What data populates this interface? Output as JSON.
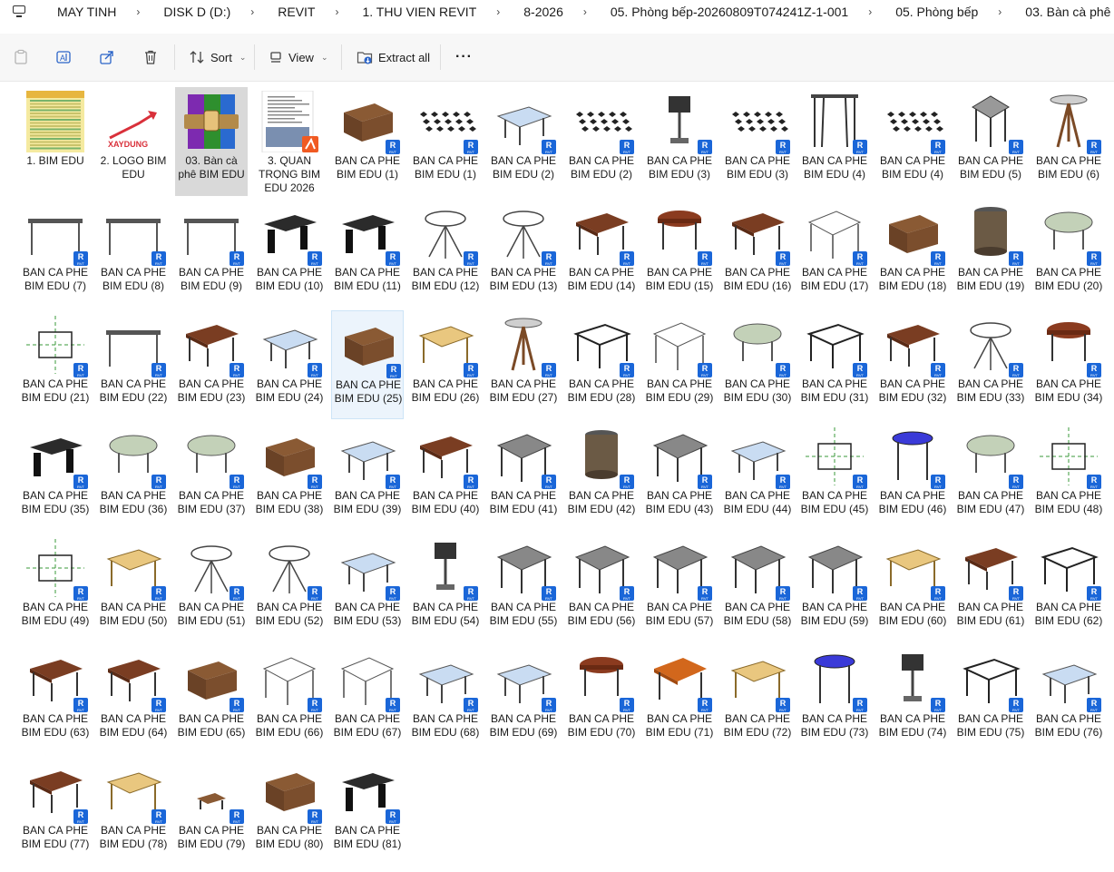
{
  "breadcrumb": {
    "items": [
      "MAY TINH",
      "DISK D (D:)",
      "REVIT",
      "1. THU VIEN REVIT",
      "8-2026",
      "05. Phòng bếp-20260809T074241Z-1-001",
      "05. Phòng bếp",
      "03. Bàn cà phê"
    ],
    "separator": "›"
  },
  "toolbar": {
    "sort_label": "Sort",
    "view_label": "View",
    "extract_label": "Extract all",
    "more_label": "···"
  },
  "badge": {
    "letter": "R",
    "sub": "RVT"
  },
  "files": [
    {
      "name": "1. BIM EDU",
      "type": "image"
    },
    {
      "name": "2. LOGO BIM EDU",
      "type": "logo"
    },
    {
      "name": "03. Bàn cà phê BIM EDU",
      "type": "archive",
      "selected": true
    },
    {
      "name": "3. QUAN TRỌNG BIM EDU 2026",
      "type": "doc"
    },
    {
      "name": "BAN CA PHE BIM EDU (1)",
      "type": "rvt",
      "icon": "box"
    },
    {
      "name": "BAN CA PHE BIM EDU (1)",
      "type": "rvt",
      "icon": "pattern"
    },
    {
      "name": "BAN CA PHE BIM EDU (2)",
      "type": "rvt",
      "icon": "glass"
    },
    {
      "name": "BAN CA PHE BIM EDU (2)",
      "type": "rvt",
      "icon": "pattern"
    },
    {
      "name": "BAN CA PHE BIM EDU (3)",
      "type": "rvt",
      "icon": "pedestal"
    },
    {
      "name": "BAN CA PHE BIM EDU (3)",
      "type": "rvt",
      "icon": "pattern"
    },
    {
      "name": "BAN CA PHE BIM EDU (4)",
      "type": "rvt",
      "icon": "tall"
    },
    {
      "name": "BAN CA PHE BIM EDU (4)",
      "type": "rvt",
      "icon": "pattern"
    },
    {
      "name": "BAN CA PHE BIM EDU (5)",
      "type": "rvt",
      "icon": "square"
    },
    {
      "name": "BAN CA PHE BIM EDU (6)",
      "type": "rvt",
      "icon": "tripod"
    },
    {
      "name": "BAN CA PHE BIM EDU (7)",
      "type": "rvt",
      "icon": "long"
    },
    {
      "name": "BAN CA PHE BIM EDU (8)",
      "type": "rvt",
      "icon": "long"
    },
    {
      "name": "BAN CA PHE BIM EDU (9)",
      "type": "rvt",
      "icon": "long"
    },
    {
      "name": "BAN CA PHE BIM EDU (10)",
      "type": "rvt",
      "icon": "dark"
    },
    {
      "name": "BAN CA PHE BIM EDU (11)",
      "type": "rvt",
      "icon": "dark"
    },
    {
      "name": "BAN CA PHE BIM EDU (12)",
      "type": "rvt",
      "icon": "round"
    },
    {
      "name": "BAN CA PHE BIM EDU (13)",
      "type": "rvt",
      "icon": "round"
    },
    {
      "name": "BAN CA PHE BIM EDU (14)",
      "type": "rvt",
      "icon": "wood"
    },
    {
      "name": "BAN CA PHE BIM EDU (15)",
      "type": "rvt",
      "icon": "roundwood"
    },
    {
      "name": "BAN CA PHE BIM EDU (16)",
      "type": "rvt",
      "icon": "wood"
    },
    {
      "name": "BAN CA PHE BIM EDU (17)",
      "type": "rvt",
      "icon": "white"
    },
    {
      "name": "BAN CA PHE BIM EDU (18)",
      "type": "rvt",
      "icon": "box"
    },
    {
      "name": "BAN CA PHE BIM EDU (19)",
      "type": "rvt",
      "icon": "drum"
    },
    {
      "name": "BAN CA PHE BIM EDU (20)",
      "type": "rvt",
      "icon": "oval"
    },
    {
      "name": "BAN CA PHE BIM EDU (21)",
      "type": "rvt",
      "icon": "plan"
    },
    {
      "name": "BAN CA PHE BIM EDU (22)",
      "type": "rvt",
      "icon": "long"
    },
    {
      "name": "BAN CA PHE BIM EDU (23)",
      "type": "rvt",
      "icon": "wood"
    },
    {
      "name": "BAN CA PHE BIM EDU (24)",
      "type": "rvt",
      "icon": "glass"
    },
    {
      "name": "BAN CA PHE BIM EDU (25)",
      "type": "rvt",
      "icon": "box",
      "hover": true
    },
    {
      "name": "BAN CA PHE BIM EDU (26)",
      "type": "rvt",
      "icon": "yellow"
    },
    {
      "name": "BAN CA PHE BIM EDU (27)",
      "type": "rvt",
      "icon": "tripod"
    },
    {
      "name": "BAN CA PHE BIM EDU (28)",
      "type": "rvt",
      "icon": "frame"
    },
    {
      "name": "BAN CA PHE BIM EDU (29)",
      "type": "rvt",
      "icon": "white"
    },
    {
      "name": "BAN CA PHE BIM EDU (30)",
      "type": "rvt",
      "icon": "oval"
    },
    {
      "name": "BAN CA PHE BIM EDU (31)",
      "type": "rvt",
      "icon": "frame"
    },
    {
      "name": "BAN CA PHE BIM EDU (32)",
      "type": "rvt",
      "icon": "wood"
    },
    {
      "name": "BAN CA PHE BIM EDU (33)",
      "type": "rvt",
      "icon": "round"
    },
    {
      "name": "BAN CA PHE BIM EDU (34)",
      "type": "rvt",
      "icon": "roundwood"
    },
    {
      "name": "BAN CA PHE BIM EDU (35)",
      "type": "rvt",
      "icon": "dark"
    },
    {
      "name": "BAN CA PHE BIM EDU (36)",
      "type": "rvt",
      "icon": "oval"
    },
    {
      "name": "BAN CA PHE BIM EDU (37)",
      "type": "rvt",
      "icon": "oval"
    },
    {
      "name": "BAN CA PHE BIM EDU (38)",
      "type": "rvt",
      "icon": "box"
    },
    {
      "name": "BAN CA PHE BIM EDU (39)",
      "type": "rvt",
      "icon": "glass"
    },
    {
      "name": "BAN CA PHE BIM EDU (40)",
      "type": "rvt",
      "icon": "wood"
    },
    {
      "name": "BAN CA PHE BIM EDU (41)",
      "type": "rvt",
      "icon": "gray"
    },
    {
      "name": "BAN CA PHE BIM EDU (42)",
      "type": "rvt",
      "icon": "drum"
    },
    {
      "name": "BAN CA PHE BIM EDU (43)",
      "type": "rvt",
      "icon": "gray"
    },
    {
      "name": "BAN CA PHE BIM EDU (44)",
      "type": "rvt",
      "icon": "glass"
    },
    {
      "name": "BAN CA PHE BIM EDU (45)",
      "type": "rvt",
      "icon": "plan"
    },
    {
      "name": "BAN CA PHE BIM EDU (46)",
      "type": "rvt",
      "icon": "blue"
    },
    {
      "name": "BAN CA PHE BIM EDU (47)",
      "type": "rvt",
      "icon": "oval"
    },
    {
      "name": "BAN CA PHE BIM EDU (48)",
      "type": "rvt",
      "icon": "plan"
    },
    {
      "name": "BAN CA PHE BIM EDU (49)",
      "type": "rvt",
      "icon": "plan"
    },
    {
      "name": "BAN CA PHE BIM EDU (50)",
      "type": "rvt",
      "icon": "yellow"
    },
    {
      "name": "BAN CA PHE BIM EDU (51)",
      "type": "rvt",
      "icon": "round"
    },
    {
      "name": "BAN CA PHE BIM EDU (52)",
      "type": "rvt",
      "icon": "round"
    },
    {
      "name": "BAN CA PHE BIM EDU (53)",
      "type": "rvt",
      "icon": "glass"
    },
    {
      "name": "BAN CA PHE BIM EDU (54)",
      "type": "rvt",
      "icon": "pedestal"
    },
    {
      "name": "BAN CA PHE BIM EDU (55)",
      "type": "rvt",
      "icon": "gray"
    },
    {
      "name": "BAN CA PHE BIM EDU (56)",
      "type": "rvt",
      "icon": "gray"
    },
    {
      "name": "BAN CA PHE BIM EDU (57)",
      "type": "rvt",
      "icon": "gray"
    },
    {
      "name": "BAN CA PHE BIM EDU (58)",
      "type": "rvt",
      "icon": "gray"
    },
    {
      "name": "BAN CA PHE BIM EDU (59)",
      "type": "rvt",
      "icon": "gray"
    },
    {
      "name": "BAN CA PHE BIM EDU (60)",
      "type": "rvt",
      "icon": "yellow"
    },
    {
      "name": "BAN CA PHE BIM EDU (61)",
      "type": "rvt",
      "icon": "wood"
    },
    {
      "name": "BAN CA PHE BIM EDU (62)",
      "type": "rvt",
      "icon": "frame"
    },
    {
      "name": "BAN CA PHE BIM EDU (63)",
      "type": "rvt",
      "icon": "wood"
    },
    {
      "name": "BAN CA PHE BIM EDU (64)",
      "type": "rvt",
      "icon": "wood"
    },
    {
      "name": "BAN CA PHE BIM EDU (65)",
      "type": "rvt",
      "icon": "box"
    },
    {
      "name": "BAN CA PHE BIM EDU (66)",
      "type": "rvt",
      "icon": "white"
    },
    {
      "name": "BAN CA PHE BIM EDU (67)",
      "type": "rvt",
      "icon": "white"
    },
    {
      "name": "BAN CA PHE BIM EDU (68)",
      "type": "rvt",
      "icon": "glass"
    },
    {
      "name": "BAN CA PHE BIM EDU (69)",
      "type": "rvt",
      "icon": "glass"
    },
    {
      "name": "BAN CA PHE BIM EDU (70)",
      "type": "rvt",
      "icon": "roundwood"
    },
    {
      "name": "BAN CA PHE BIM EDU (71)",
      "type": "rvt",
      "icon": "orange"
    },
    {
      "name": "BAN CA PHE BIM EDU (72)",
      "type": "rvt",
      "icon": "yellow"
    },
    {
      "name": "BAN CA PHE BIM EDU (73)",
      "type": "rvt",
      "icon": "blue"
    },
    {
      "name": "BAN CA PHE BIM EDU (74)",
      "type": "rvt",
      "icon": "pedestal"
    },
    {
      "name": "BAN CA PHE BIM EDU (75)",
      "type": "rvt",
      "icon": "frame"
    },
    {
      "name": "BAN CA PHE BIM EDU (76)",
      "type": "rvt",
      "icon": "glass"
    },
    {
      "name": "BAN CA PHE BIM EDU (77)",
      "type": "rvt",
      "icon": "wood"
    },
    {
      "name": "BAN CA PHE BIM EDU (78)",
      "type": "rvt",
      "icon": "yellow"
    },
    {
      "name": "BAN CA PHE BIM EDU (79)",
      "type": "rvt",
      "icon": "small"
    },
    {
      "name": "BAN CA PHE BIM EDU (80)",
      "type": "rvt",
      "icon": "box"
    },
    {
      "name": "BAN CA PHE BIM EDU (81)",
      "type": "rvt",
      "icon": "dark"
    }
  ]
}
